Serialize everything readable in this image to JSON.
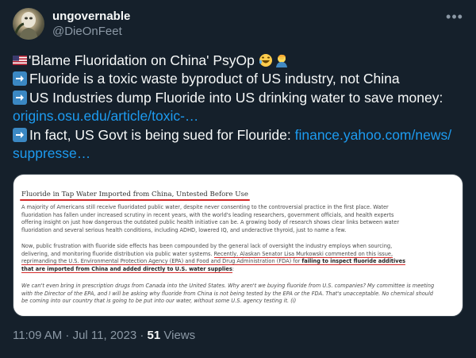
{
  "author": {
    "display_name": "ungovernable",
    "handle": "@DieOnFeet"
  },
  "more_icon": "more-horizontal-icon",
  "tweet": {
    "line1": "'Blame Fluoridation on China' PsyOp",
    "line1_icons": [
      "us-flag-icon",
      "rofl-emoji-icon",
      "facepalm-emoji-icon"
    ],
    "line2": "Fluoride is a toxic waste byproduct of US industry, not China",
    "line3": "US Industries dump Fluoride into US drinking water to save money:",
    "link1": "origins.osu.edu/article/toxic-…",
    "line4": "In fact, US Govt is being sued for Flouride: ",
    "link2_part1": "finance.yahoo.com/news/",
    "link2_part2": "suppresse…",
    "bullet_icon": "right-arrow-icon"
  },
  "media": {
    "title": "Fluoride in Tap Water Imported from China, Untested Before Use",
    "para1": [
      "A majority of Americans still receive fluoridated public water, despite never consenting to the controversial practice in the first place. Water",
      "fluoridation has fallen under increased scrutiny in recent years, with the world's leading researchers, government officials, and health experts",
      "offering insight on just how dangerous the outdated public health initiative can be. A growing body of research shows clear links between water",
      "fluoridation and several serious health conditions, including ADHD, lowered IQ, and underactive thyroid, just to name a few."
    ],
    "para2_line1": "Now, public frustration with fluoride side effects has been compounded by the general lack of oversight the industry employs when sourcing,",
    "para2_line2_a": "delivering, and monitoring fluoride distribution via public water systems. ",
    "para2_line2_b": "Recently, Alaskan Senator Lisa Murkowski commented on this issue,",
    "para2_line3_a": "reprimanding the U.S. Environmental Protection Agency (EPA) and Food and Drug Administration (FDA) for ",
    "para2_line3_b": "failing to inspect fluoride additives",
    "para2_line4": "that are imported from China and added directly to U.S. water supplies",
    "para2_line4_tail": ":",
    "para3": [
      "We can't even bring in prescription drugs from Canada into the United States. Why aren't we buying fluoride from U.S. companies?  My committee is meeting",
      "with the Director of the EPA, and I will be asking why fluoride from China is not being tested by the EPA or the FDA. That's unacceptable. No chemical should",
      "be coming into our country that is going to be put into our water, without some U.S. agency testing it. (i)"
    ]
  },
  "meta": {
    "time": "11:09 AM · Jul 11, 2023 · ",
    "views_count": "51",
    "views_label": " Views"
  }
}
